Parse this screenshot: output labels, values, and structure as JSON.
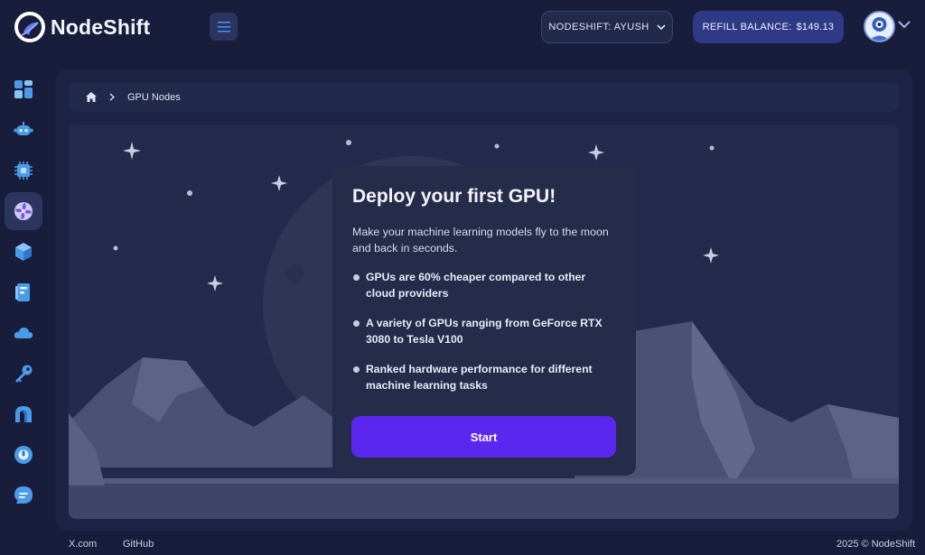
{
  "brand": {
    "name": "NodeShift"
  },
  "header": {
    "org_label": "NODESHIFT: AYUSH",
    "refill_label": "REFILL BALANCE:",
    "refill_amount": "$149.13"
  },
  "sidebar": {
    "items": [
      {
        "icon": "dashboard-icon",
        "active": false
      },
      {
        "icon": "robot-icon",
        "active": false
      },
      {
        "icon": "cpu-icon",
        "active": false
      },
      {
        "icon": "gpu-fan-icon",
        "active": true
      },
      {
        "icon": "cube-icon",
        "active": false
      },
      {
        "icon": "storage-icon",
        "active": false
      },
      {
        "icon": "cloud-icon",
        "active": false
      },
      {
        "icon": "key-icon",
        "active": false
      },
      {
        "icon": "arch-icon",
        "active": false
      },
      {
        "icon": "disk-icon",
        "active": false
      },
      {
        "icon": "chat-icon",
        "active": false
      }
    ]
  },
  "breadcrumb": {
    "current": "GPU Nodes"
  },
  "card": {
    "title": "Deploy your first GPU!",
    "subtitle": "Make your machine learning models fly to the moon and back in seconds.",
    "bullets": [
      "GPUs are 60% cheaper compared to other cloud providers",
      "A variety of GPUs ranging from GeForce RTX 3080 to Tesla V100",
      "Ranked hardware performance for different machine learning tasks"
    ],
    "button_label": "Start"
  },
  "footer": {
    "links": [
      "X.com",
      "GitHub"
    ],
    "copyright": "2025 © NodeShift"
  },
  "colors": {
    "background": "#171d3a",
    "panel": "#1c2345",
    "accent": "#5b27ee",
    "refill": "#2f3a86",
    "icon_blue": "#3d8fe0"
  }
}
